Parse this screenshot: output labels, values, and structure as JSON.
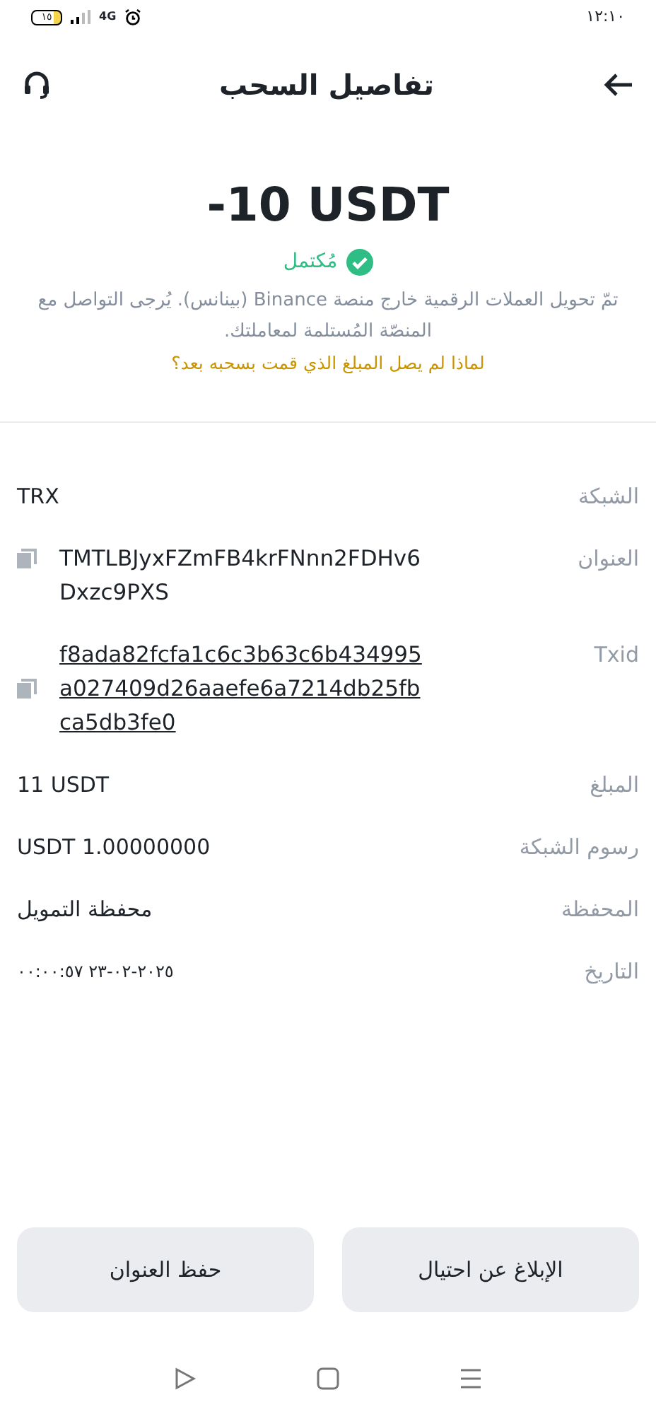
{
  "status_bar": {
    "time": "١٢:١٠",
    "battery": "١٥",
    "network": "4G"
  },
  "header": {
    "title": "تفاصيل السحب"
  },
  "summary": {
    "amount": "-10 USDT",
    "status": "مُكتمل",
    "note": "تمّ تحويل العملات الرقمية خارج منصة Binance (بينانس). يُرجى التواصل مع المنصّة المُستلمة لمعاملتك.",
    "link": "لماذا لم يصل المبلغ الذي قمت بسحبه بعد؟"
  },
  "details": [
    {
      "label": "الشبكة",
      "value": "TRX",
      "kind": "text"
    },
    {
      "label": "العنوان",
      "value": "TMTLBJyxFZmFB4krFNnn2FDHv6Dxzc9PXS",
      "kind": "copy"
    },
    {
      "label": "Txid",
      "value": "f8ada82fcfa1c6c3b63c6b434995a027409d26aaefe6a7214db25fbca5db3fe0",
      "kind": "link"
    },
    {
      "label": "المبلغ",
      "value": "11 USDT",
      "kind": "text"
    },
    {
      "label": "رسوم الشبكة",
      "value": "USDT 1.00000000",
      "kind": "text"
    },
    {
      "label": "المحفظة",
      "value": "محفظة التمويل",
      "kind": "text"
    },
    {
      "label": "التاريخ",
      "value": "٢٠٢٥-٠٢-٢٣ ٠٠:٠٠:٥٧",
      "kind": "small"
    }
  ],
  "buttons": [
    "الإبلاغ عن احتيال",
    "حفظ العنوان"
  ]
}
